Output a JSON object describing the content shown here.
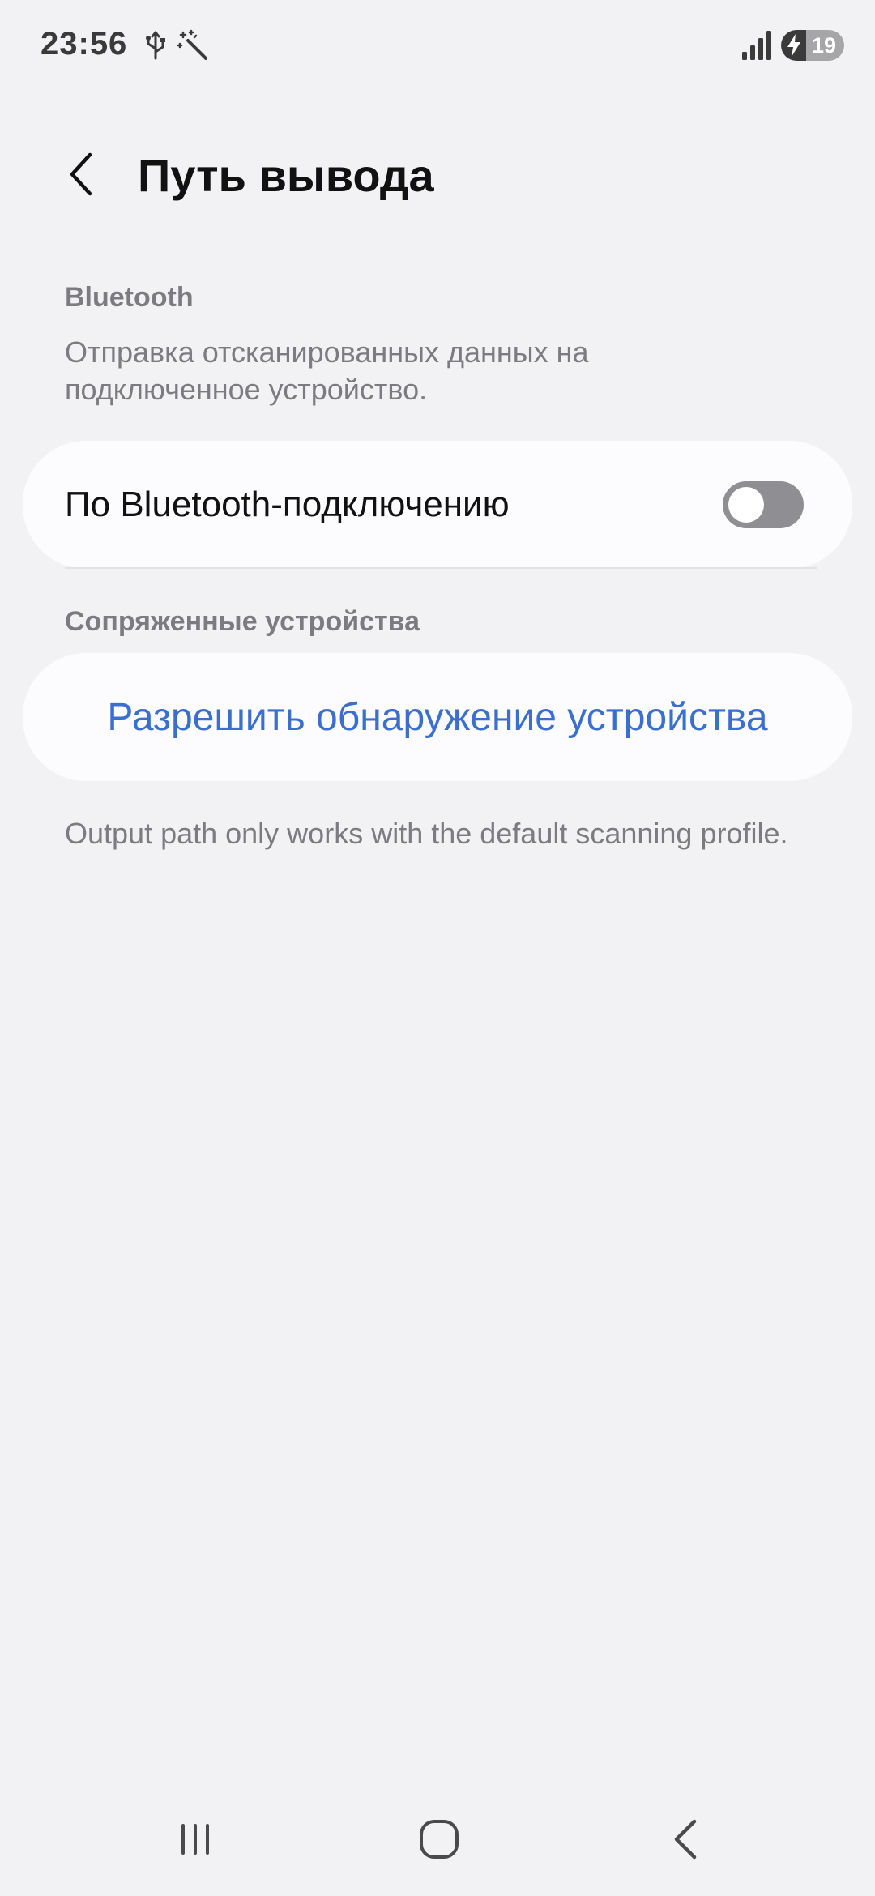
{
  "status_bar": {
    "time": "23:56",
    "icons": [
      "usb-icon",
      "magic-wand-icon",
      "signal-icon",
      "battery-charging-icon"
    ],
    "battery_level": "19",
    "battery_fraction": 0.19
  },
  "header": {
    "back_icon": "chevron-left-icon",
    "title": "Путь вывода"
  },
  "bluetooth_section": {
    "label": "Bluetooth",
    "description": "Отправка отсканированных данных на подключенное устройство.",
    "toggle_label": "По Bluetooth-подключению",
    "toggle_on": false
  },
  "paired_section": {
    "label": "Сопряженные устройства",
    "action_label": "Разрешить обнаружение устройства"
  },
  "footer_note": "Output path only works with the default scanning profile.",
  "nav_bar": {
    "icons": [
      "recent-apps-icon",
      "home-icon",
      "back-icon"
    ]
  },
  "colors": {
    "background": "#f2f2f4",
    "card": "#fcfcfe",
    "accent_link": "#3a6fd0",
    "secondary_text": "#7c7c80",
    "switch_off": "#8e8e93"
  }
}
